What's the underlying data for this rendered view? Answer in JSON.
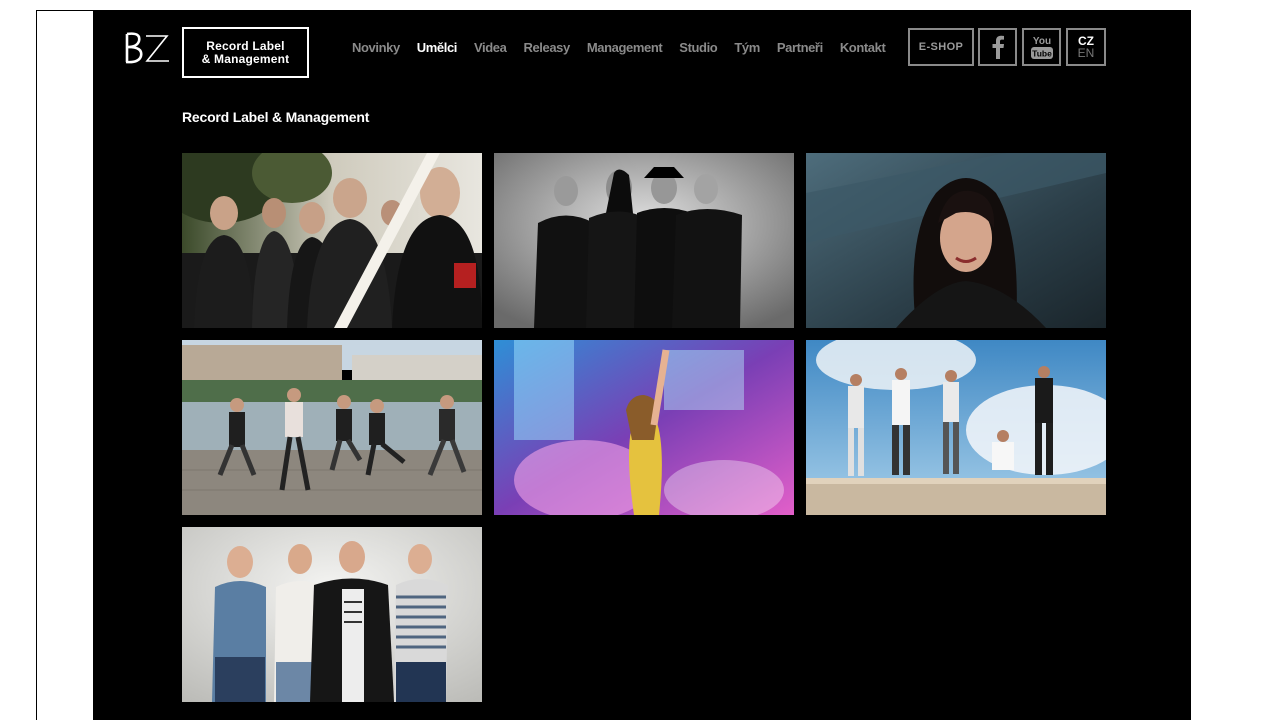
{
  "brand": {
    "logo_text": "BZ",
    "label_line1": "Record Label",
    "label_line2": "& Management"
  },
  "nav": {
    "items": [
      {
        "label": "Novinky"
      },
      {
        "label": "Umělci",
        "active": true
      },
      {
        "label": "Videa"
      },
      {
        "label": "Releasy"
      },
      {
        "label": "Management"
      },
      {
        "label": "Studio"
      },
      {
        "label": "Tým"
      },
      {
        "label": "Partneři"
      },
      {
        "label": "Kontakt"
      }
    ]
  },
  "header_buttons": {
    "eshop": "E-SHOP",
    "facebook_icon": "facebook-icon",
    "youtube_icon": "youtube-icon",
    "youtube_text_top": "You",
    "youtube_text_bottom": "Tube",
    "lang_active": "CZ",
    "lang_other": "EN"
  },
  "page": {
    "title": "Record Label & Management"
  },
  "artists": [
    {
      "photo": "band-five-men-outdoor"
    },
    {
      "photo": "band-four-men-black"
    },
    {
      "photo": "singer-woman-dark-hair"
    },
    {
      "photo": "band-riverside-dancing"
    },
    {
      "photo": "singer-woman-stage-lights"
    },
    {
      "photo": "band-on-wall-sky"
    },
    {
      "photo": "band-four-young-men-studio"
    }
  ]
}
